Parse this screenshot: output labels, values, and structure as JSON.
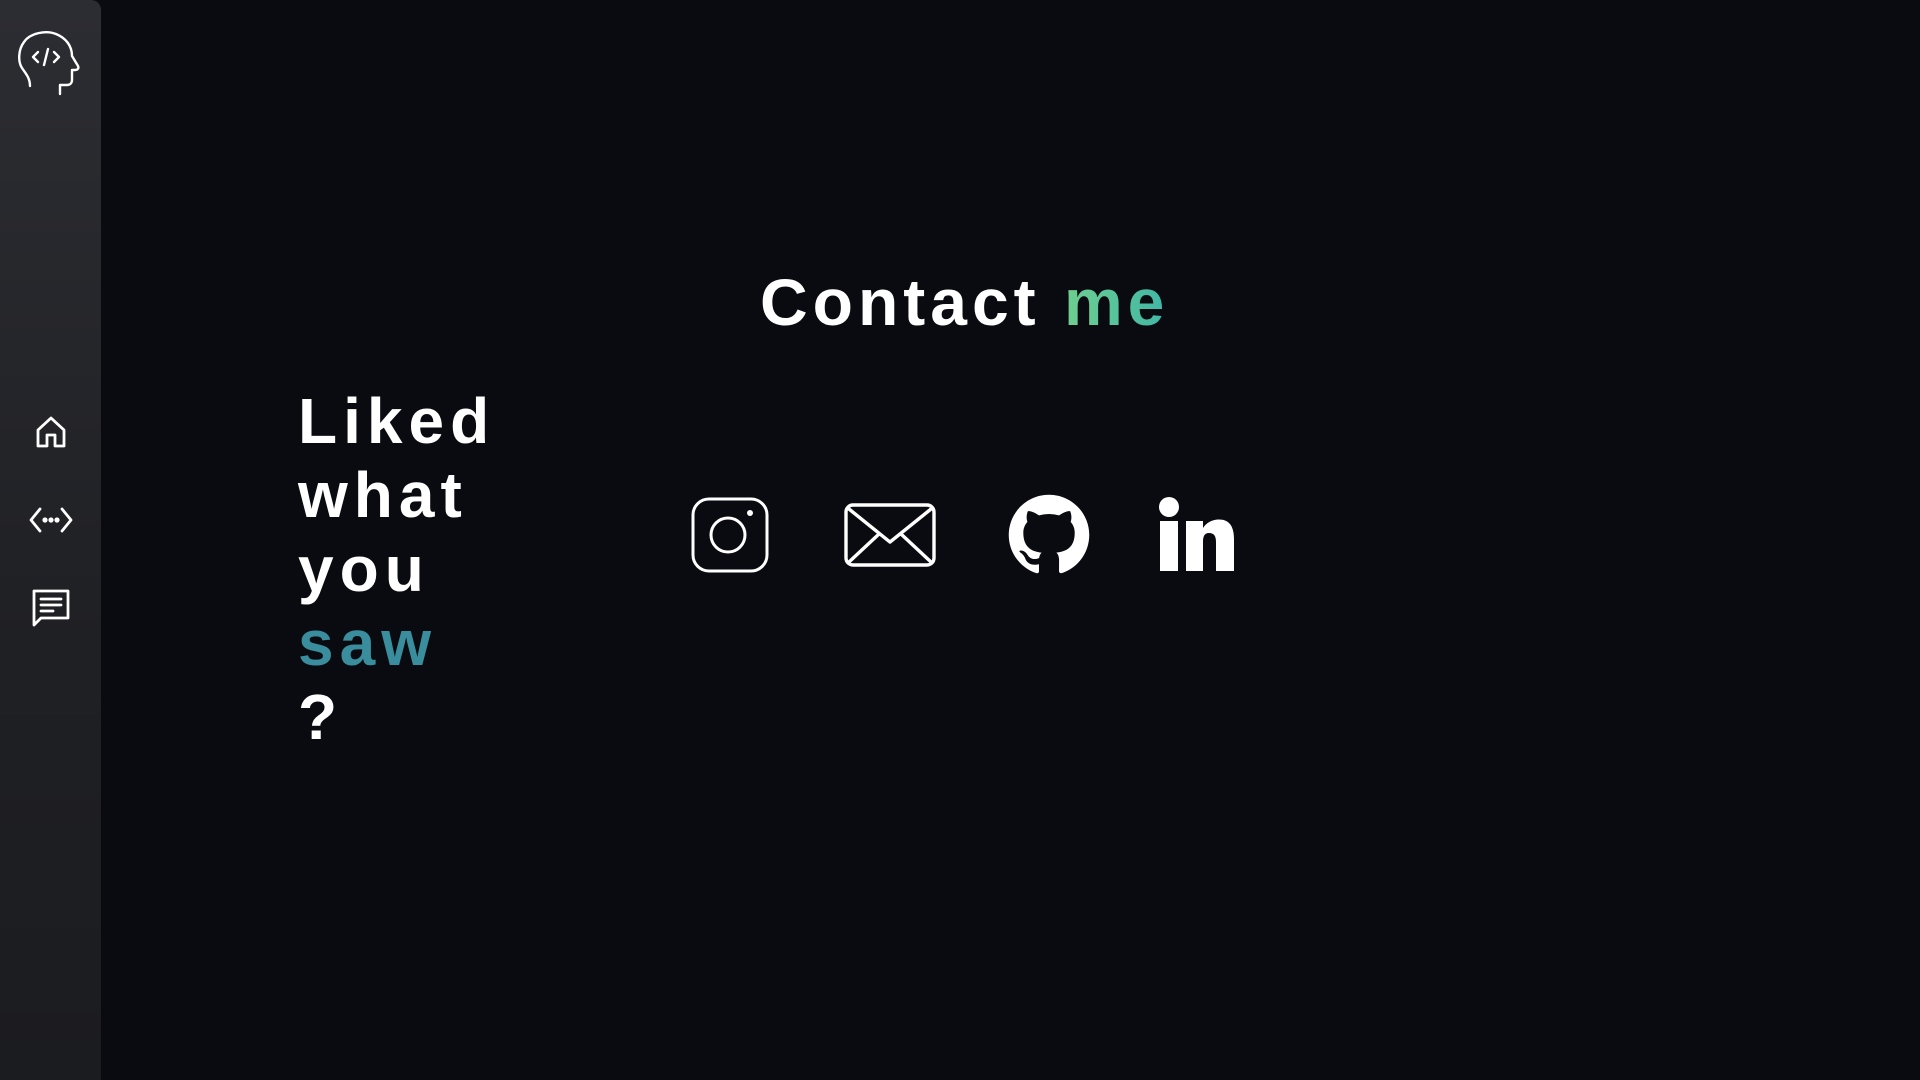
{
  "sidebar": {
    "logo_icon": "head-code-icon",
    "items": [
      {
        "name": "home",
        "icon": "home-icon"
      },
      {
        "name": "projects",
        "icon": "code-arrows-icon"
      },
      {
        "name": "contact",
        "icon": "message-icon"
      }
    ]
  },
  "main": {
    "title_prefix": "Contact ",
    "title_accent": "me",
    "tagline": {
      "line1": "Liked",
      "line2": "what",
      "line3": "you",
      "line4_accent": "saw",
      "line4_suffix": "?"
    },
    "socials": [
      {
        "name": "instagram",
        "icon": "instagram-icon"
      },
      {
        "name": "email",
        "icon": "mail-icon"
      },
      {
        "name": "github",
        "icon": "github-icon"
      },
      {
        "name": "linkedin",
        "icon": "linkedin-icon"
      }
    ]
  },
  "colors": {
    "background": "#0a0b10",
    "sidebar": "#26272b",
    "title_accent_start": "#6fd08f",
    "title_accent_end": "#3fb6a6",
    "tagline_accent": "#3a8d9c",
    "icon": "#ffffff"
  }
}
